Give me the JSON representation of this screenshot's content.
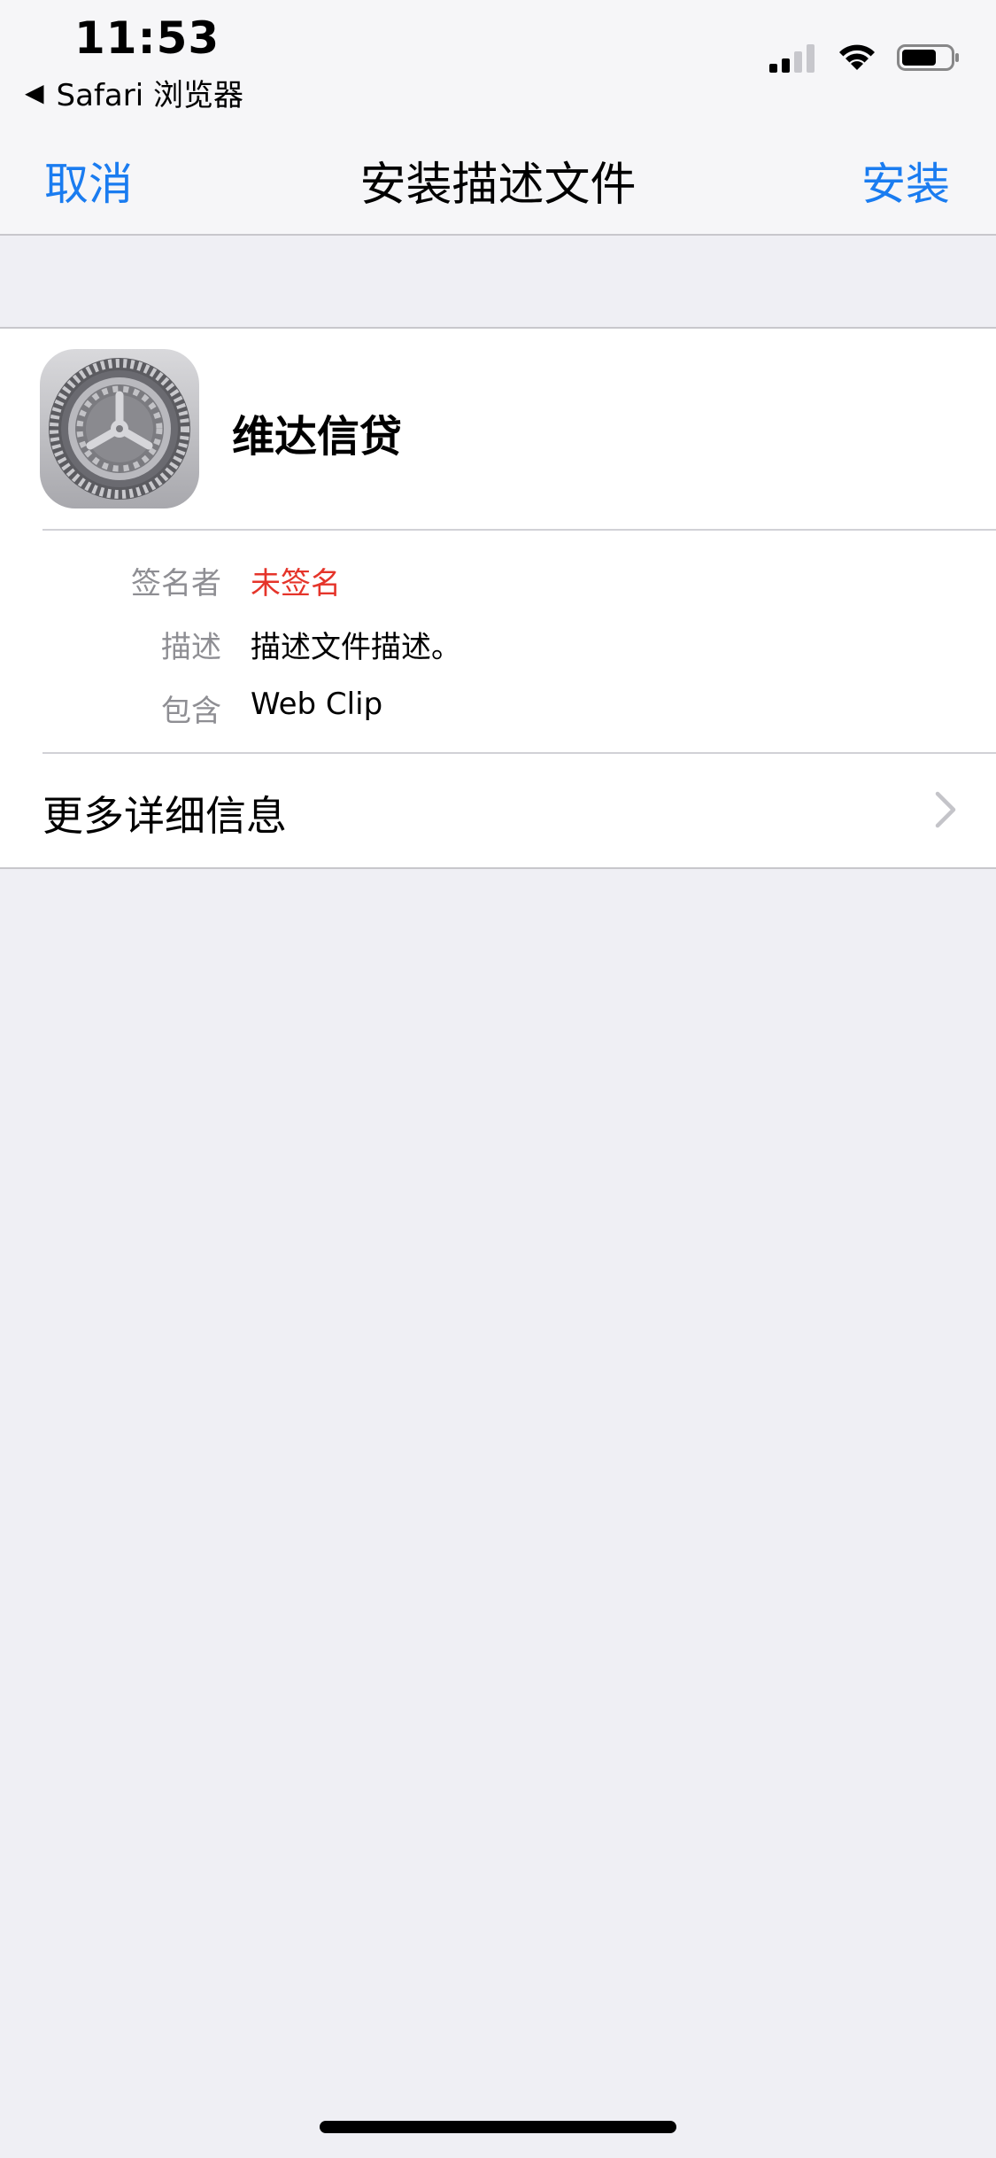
{
  "status_bar": {
    "time": "11:53",
    "back_app": "Safari 浏览器",
    "icons": [
      "back-triangle-icon",
      "cellular-signal-icon",
      "wifi-icon",
      "battery-icon"
    ]
  },
  "nav": {
    "cancel": "取消",
    "title": "安装描述文件",
    "install": "安装",
    "accent_color": "#1a7cf0"
  },
  "profile": {
    "name": "维达信贷",
    "icon": "settings-gear-icon",
    "details": [
      {
        "label": "签名者",
        "value": "未签名",
        "value_color": "#e5342a"
      },
      {
        "label": "描述",
        "value": "描述文件描述。"
      },
      {
        "label": "包含",
        "value": "Web Clip"
      }
    ],
    "more": "更多详细信息"
  }
}
